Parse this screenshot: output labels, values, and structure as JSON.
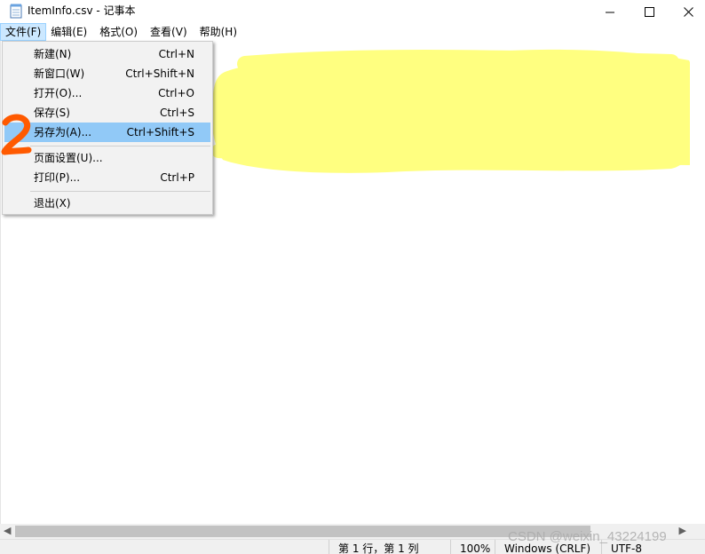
{
  "window": {
    "title": "ItemInfo.csv - 记事本",
    "min_glyph": "—",
    "max_glyph": "☐",
    "close_glyph": "✕"
  },
  "menubar": {
    "items": [
      {
        "label": "文件(F)"
      },
      {
        "label": "编辑(E)"
      },
      {
        "label": "格式(O)"
      },
      {
        "label": "查看(V)"
      },
      {
        "label": "帮助(H)"
      }
    ]
  },
  "file_menu": {
    "items": [
      {
        "label": "新建(N)",
        "shortcut": "Ctrl+N"
      },
      {
        "label": "新窗口(W)",
        "shortcut": "Ctrl+Shift+N"
      },
      {
        "label": "打开(O)...",
        "shortcut": "Ctrl+O"
      },
      {
        "label": "保存(S)",
        "shortcut": "Ctrl+S"
      },
      {
        "label": "另存为(A)...",
        "shortcut": "Ctrl+Shift+S"
      },
      {
        "label": "页面设置(U)...",
        "shortcut": ""
      },
      {
        "label": "打印(P)...",
        "shortcut": "Ctrl+P"
      },
      {
        "label": "退出(X)",
        "shortcut": ""
      }
    ],
    "highlighted_item": "另存为(A)..."
  },
  "statusbar": {
    "position": "第 1 行，第 1 列",
    "zoom": "100%",
    "line_ending": "Windows (CRLF)",
    "encoding": "UTF-8"
  },
  "watermark": "CSDN @weixin_43224199",
  "colors": {
    "menu_highlight": "#91c9f7",
    "redaction": "#ffff80",
    "annotation": "#ff5a00"
  },
  "icons": [
    "notepad-icon",
    "minimize-icon",
    "maximize-icon",
    "close-icon",
    "scroll-left-icon",
    "scroll-right-icon"
  ]
}
